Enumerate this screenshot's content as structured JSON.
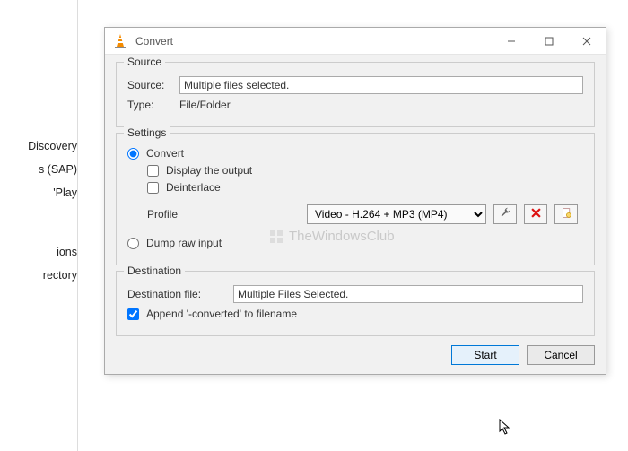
{
  "window": {
    "title": "Convert"
  },
  "bg_sidebar": {
    "items": [
      "Discovery",
      "s (SAP)",
      "'Play",
      "",
      "",
      "ions",
      "rectory"
    ]
  },
  "source": {
    "legend": "Source",
    "source_label": "Source:",
    "source_value": "Multiple files selected.",
    "type_label": "Type:",
    "type_value": "File/Folder"
  },
  "settings": {
    "legend": "Settings",
    "convert_label": "Convert",
    "convert_checked": true,
    "display_output_label": "Display the output",
    "display_output_checked": false,
    "deinterlace_label": "Deinterlace",
    "deinterlace_checked": false,
    "profile_label": "Profile",
    "profile_value": "Video - H.264 + MP3 (MP4)",
    "dump_label": "Dump raw input",
    "dump_checked": false
  },
  "destination": {
    "legend": "Destination",
    "file_label": "Destination file:",
    "file_value": "Multiple Files Selected.",
    "append_label": "Append '-converted' to filename",
    "append_checked": true
  },
  "buttons": {
    "start": "Start",
    "cancel": "Cancel"
  },
  "watermark": "TheWindowsClub"
}
